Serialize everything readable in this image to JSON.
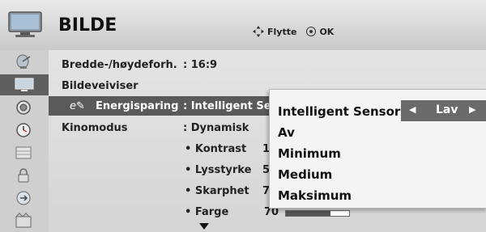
{
  "header": {
    "title": "BILDE",
    "hint_move": "Flytte",
    "hint_ok": "OK"
  },
  "sidebar": {
    "items": [
      {
        "icon": "satellite-dish-icon"
      },
      {
        "icon": "tv-picture-icon",
        "active": true
      },
      {
        "icon": "speaker-icon"
      },
      {
        "icon": "clock-icon"
      },
      {
        "icon": "options-grid-icon"
      },
      {
        "icon": "lock-icon"
      },
      {
        "icon": "input-plug-icon"
      },
      {
        "icon": "usb-media-icon"
      }
    ]
  },
  "menu": {
    "aspect_label": "Bredde-/høydeforh.",
    "aspect_value": ": 16:9",
    "guide_label": "Bildeveiviser",
    "energy_label": "Energisparing",
    "energy_value": ": Intelligent Se",
    "mode_label": "Kinomodus",
    "mode_value": ": Dynamisk",
    "contrast_label": "Kontrast",
    "contrast_value": "1",
    "brightness_label": "Lysstyrke",
    "brightness_value": "5",
    "sharpness_label": "Skarphet",
    "sharpness_value": "7",
    "color_label": "Farge",
    "color_value": "70",
    "color_level": 0.7
  },
  "popup": {
    "options": [
      "Intelligent Sensor",
      "Av",
      "Minimum",
      "Medium",
      "Maksimum"
    ],
    "selected_value": "Lav"
  },
  "colors": {
    "header_bg": "#d4d4d4",
    "selected_row": "#5a5a5a",
    "popup_bg": "#f4f4f4"
  }
}
